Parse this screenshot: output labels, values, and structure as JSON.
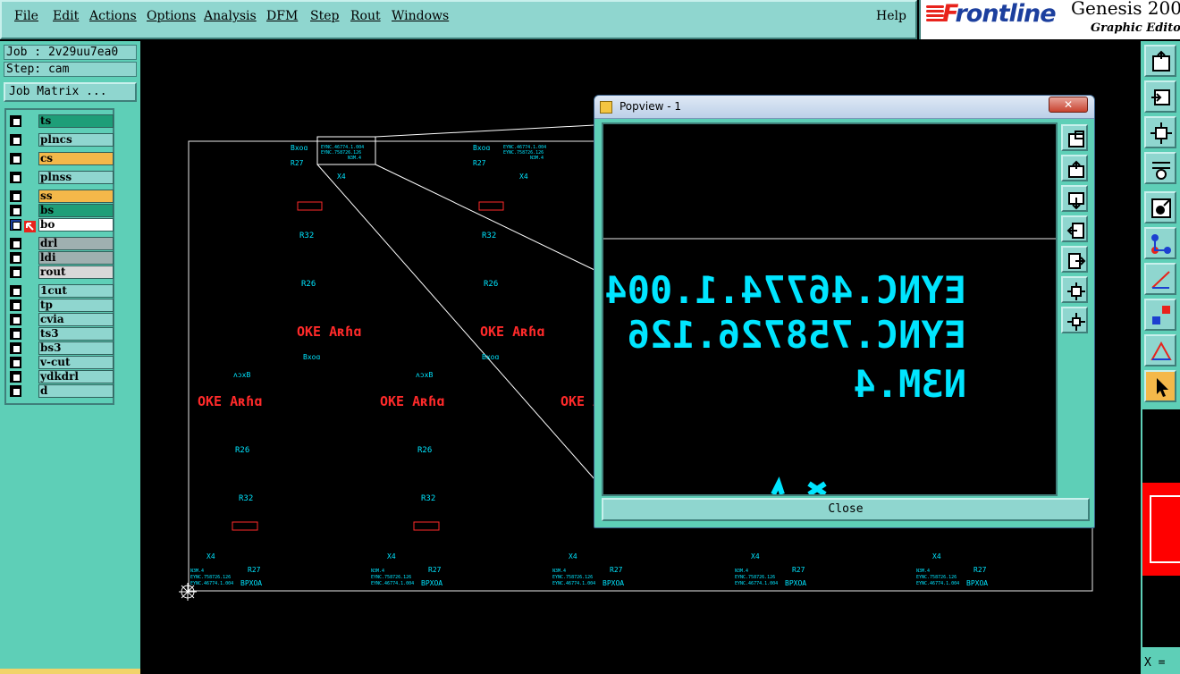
{
  "menu": {
    "items": [
      "File",
      "Edit",
      "Actions",
      "Options",
      "Analysis",
      "DFM",
      "Step",
      "Rout",
      "Windows"
    ],
    "help": "Help"
  },
  "logo": {
    "brand_first": "F",
    "brand_rest": "rontline",
    "product": "Genesis 200",
    "subtitle": "Graphic Editor"
  },
  "job": {
    "job_line": "Job : 2v29uu7ea0",
    "step_line": "Step: cam",
    "matrix_label": "Job Matrix ..."
  },
  "layers": [
    {
      "name": "ts",
      "color": "#1e9e78"
    },
    {
      "name": "plncs",
      "color": "#8fd6cf"
    },
    {
      "name": "cs",
      "color": "#f4b84a"
    },
    {
      "name": "plnss",
      "color": "#8fd6cf"
    },
    {
      "name": "ss",
      "color": "#f4b84a"
    },
    {
      "name": "bs",
      "color": "#1e9e78"
    },
    {
      "name": "bo",
      "color": "#ffffff"
    },
    {
      "name": "drl",
      "color": "#9fb0b0"
    },
    {
      "name": "ldi",
      "color": "#9fb0b0"
    },
    {
      "name": "rout",
      "color": "#d8d8d8"
    },
    {
      "name": "1cut",
      "color": "#8fd6cf"
    },
    {
      "name": "tp",
      "color": "#8fd6cf"
    },
    {
      "name": "cvia",
      "color": "#8fd6cf"
    },
    {
      "name": "ts3",
      "color": "#8fd6cf"
    },
    {
      "name": "bs3",
      "color": "#8fd6cf"
    },
    {
      "name": "v-cut",
      "color": "#8fd6cf"
    },
    {
      "name": "ydkdrl",
      "color": "#8fd6cf"
    },
    {
      "name": "d",
      "color": "#8fd6cf"
    }
  ],
  "popview": {
    "title": "Popview - 1",
    "close_button": "Close",
    "zoom_text": [
      "EYNC.46774.1.004",
      "EYNC.758726.126",
      "N3M.4"
    ]
  },
  "coord_label": "X =",
  "canvas": {
    "labels_top": [
      "Bxoɑ",
      "R27",
      "X4",
      "R32",
      "R26",
      "OKE Aʀɦɑ",
      "Bxoɑ",
      "ʌɔxB",
      "OKE Aʀɦɑ",
      "R26",
      "R32"
    ],
    "row_labels": [
      "X4",
      "R27",
      "BPXOA"
    ]
  },
  "colors": {
    "accent": "#8fd6cf",
    "panel": "#5ecfb7",
    "cyan": "#00e5ff",
    "red": "#ff2a2a"
  }
}
